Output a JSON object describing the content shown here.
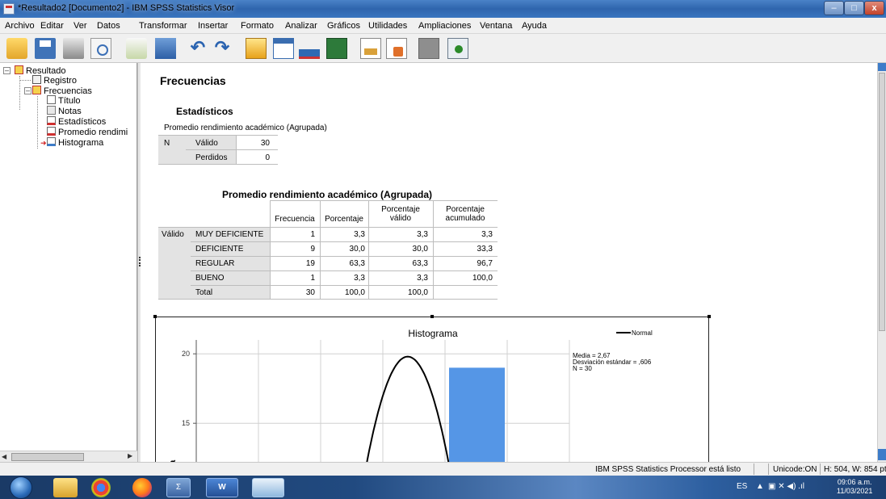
{
  "window": {
    "title": "*Resultado2 [Documento2] - IBM SPSS Statistics Visor",
    "controls": {
      "minimize": "–",
      "maximize": "□",
      "close": "x"
    }
  },
  "menu": [
    "Archivo",
    "Editar",
    "Ver",
    "Datos",
    "Transformar",
    "Insertar",
    "Formato",
    "Analizar",
    "Gráficos",
    "Utilidades",
    "Ampliaciones",
    "Ventana",
    "Ayuda"
  ],
  "toolbar": {
    "icons": [
      "open-folder-icon",
      "save-icon",
      "print-icon",
      "print-preview-icon",
      "export-icon",
      "goto-data-icon",
      "undo-icon",
      "redo-icon",
      "goto-variable-icon",
      "insert-table-icon",
      "insert-chart-icon",
      "insert-output-icon",
      "insert-doc-icon",
      "insert-script-icon",
      "disabled-icon",
      "add-icon"
    ],
    "undo_glyph": "↶",
    "redo_glyph": "↷"
  },
  "outline": {
    "root": "Resultado",
    "items": [
      "Registro",
      "Frecuencias",
      "Título",
      "Notas",
      "Estadísticos",
      "Promedio rendimi",
      "Histograma"
    ],
    "expander_glyph": "–"
  },
  "content": {
    "heading": "Frecuencias",
    "stats": {
      "title": "Estadísticos",
      "subtitle": "Promedio rendimiento académico (Agrupada)",
      "row_header": "N",
      "rows": [
        {
          "label": "Válido",
          "value": "30"
        },
        {
          "label": "Perdidos",
          "value": "0"
        }
      ]
    },
    "freq": {
      "title": "Promedio rendimiento académico (Agrupada)",
      "columns": [
        "Frecuencia",
        "Porcentaje",
        "Porcentaje válido",
        "Porcentaje acumulado"
      ],
      "columns_split": [
        [
          "Frecuencia"
        ],
        [
          "Porcentaje"
        ],
        [
          "Porcentaje",
          "válido"
        ],
        [
          "Porcentaje",
          "acumulado"
        ]
      ],
      "row_group": "Válido",
      "rows": [
        {
          "label": "MUY DEFICIENTE",
          "freq": "1",
          "pct": "3,3",
          "valid": "3,3",
          "cum": "3,3"
        },
        {
          "label": "DEFICIENTE",
          "freq": "9",
          "pct": "30,0",
          "valid": "30,0",
          "cum": "33,3"
        },
        {
          "label": "REGULAR",
          "freq": "19",
          "pct": "63,3",
          "valid": "63,3",
          "cum": "96,7"
        },
        {
          "label": "BUENO",
          "freq": "1",
          "pct": "3,3",
          "valid": "3,3",
          "cum": "100,0"
        },
        {
          "label": "Total",
          "freq": "30",
          "pct": "100,0",
          "valid": "100,0",
          "cum": ""
        }
      ]
    }
  },
  "chart_data": {
    "type": "bar",
    "title": "Histograma",
    "legend": {
      "label": "Normal",
      "placement": "top-right"
    },
    "stats_text": [
      "Media = 2,67",
      "Desviación estándar = ,606",
      "N = 30"
    ],
    "ylabel": "Frecuencia",
    "ylabel_visible": "cia",
    "yticks": [
      15,
      20
    ],
    "ylim_visible": [
      11,
      21
    ],
    "bins_visible": 6,
    "bars": [
      {
        "bin": 4,
        "value": 19
      }
    ],
    "normal_curve": {
      "mean": 2.67,
      "sd": 0.606,
      "n": 30
    },
    "grid": true,
    "bar_color": "#5596e6"
  },
  "status": {
    "processor": "IBM SPSS Statistics Processor está listo",
    "unicode": "Unicode:ON",
    "size": "H: 504, W: 854 pt."
  },
  "taskbar": {
    "apps": [
      "start-button",
      "file-explorer",
      "chrome",
      "firefox",
      "sigma-app",
      "word",
      "maps-app"
    ],
    "sigma_glyph": "Σ",
    "word_label": "W",
    "lang": "ES",
    "time": "09:06 a.m.",
    "date": "11/03/2021"
  }
}
